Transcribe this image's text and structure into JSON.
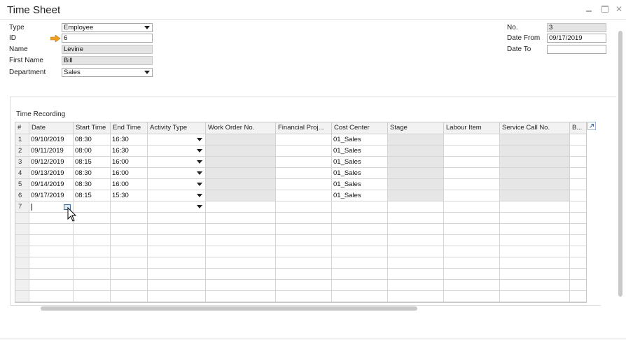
{
  "window": {
    "title": "Time Sheet"
  },
  "header": {
    "type_label": "Type",
    "type_value": "Employee",
    "id_label": "ID",
    "id_value": "6",
    "name_label": "Name",
    "name_value": "Levine",
    "first_name_label": "First Name",
    "first_name_value": "Bill",
    "department_label": "Department",
    "department_value": "Sales",
    "no_label": "No.",
    "no_value": "3",
    "date_from_label": "Date From",
    "date_from_value": "09/17/2019",
    "date_to_label": "Date To",
    "date_to_value": ""
  },
  "section": {
    "label": "Time Recording"
  },
  "grid": {
    "columns": [
      "#",
      "Date",
      "Start Time",
      "End Time",
      "Activity Type",
      "Work Order No.",
      "Financial Proj...",
      "Cost Center",
      "Stage",
      "Labour Item",
      "Service Call No.",
      "B..."
    ],
    "rows": [
      [
        "1",
        "09/10/2019",
        "08:30",
        "16:30",
        "",
        "",
        "",
        "01_Sales",
        "",
        "",
        "",
        ""
      ],
      [
        "2",
        "09/11/2019",
        "08:00",
        "16:30",
        "",
        "",
        "",
        "01_Sales",
        "",
        "",
        "",
        ""
      ],
      [
        "3",
        "09/12/2019",
        "08:15",
        "16:00",
        "",
        "",
        "",
        "01_Sales",
        "",
        "",
        "",
        ""
      ],
      [
        "4",
        "09/13/2019",
        "08:30",
        "16:00",
        "",
        "",
        "",
        "01_Sales",
        "",
        "",
        "",
        ""
      ],
      [
        "5",
        "09/14/2019",
        "08:30",
        "16:00",
        "",
        "",
        "",
        "01_Sales",
        "",
        "",
        "",
        ""
      ],
      [
        "6",
        "09/17/2019",
        "08:15",
        "15:30",
        "",
        "",
        "",
        "01_Sales",
        "",
        "",
        "",
        ""
      ],
      [
        "7",
        "",
        "",
        "",
        "",
        "",
        "",
        "",
        "",
        "",
        "",
        ""
      ]
    ]
  },
  "icons": {
    "id_link": "orange-arrow-icon",
    "expand": "expand-arrow-icon",
    "cursor": "mouse-pointer-icon"
  },
  "colors": {
    "arrow": "#f0a020",
    "readonly_field": "#e4e4e4",
    "link_blue": "#3e6ca8"
  }
}
